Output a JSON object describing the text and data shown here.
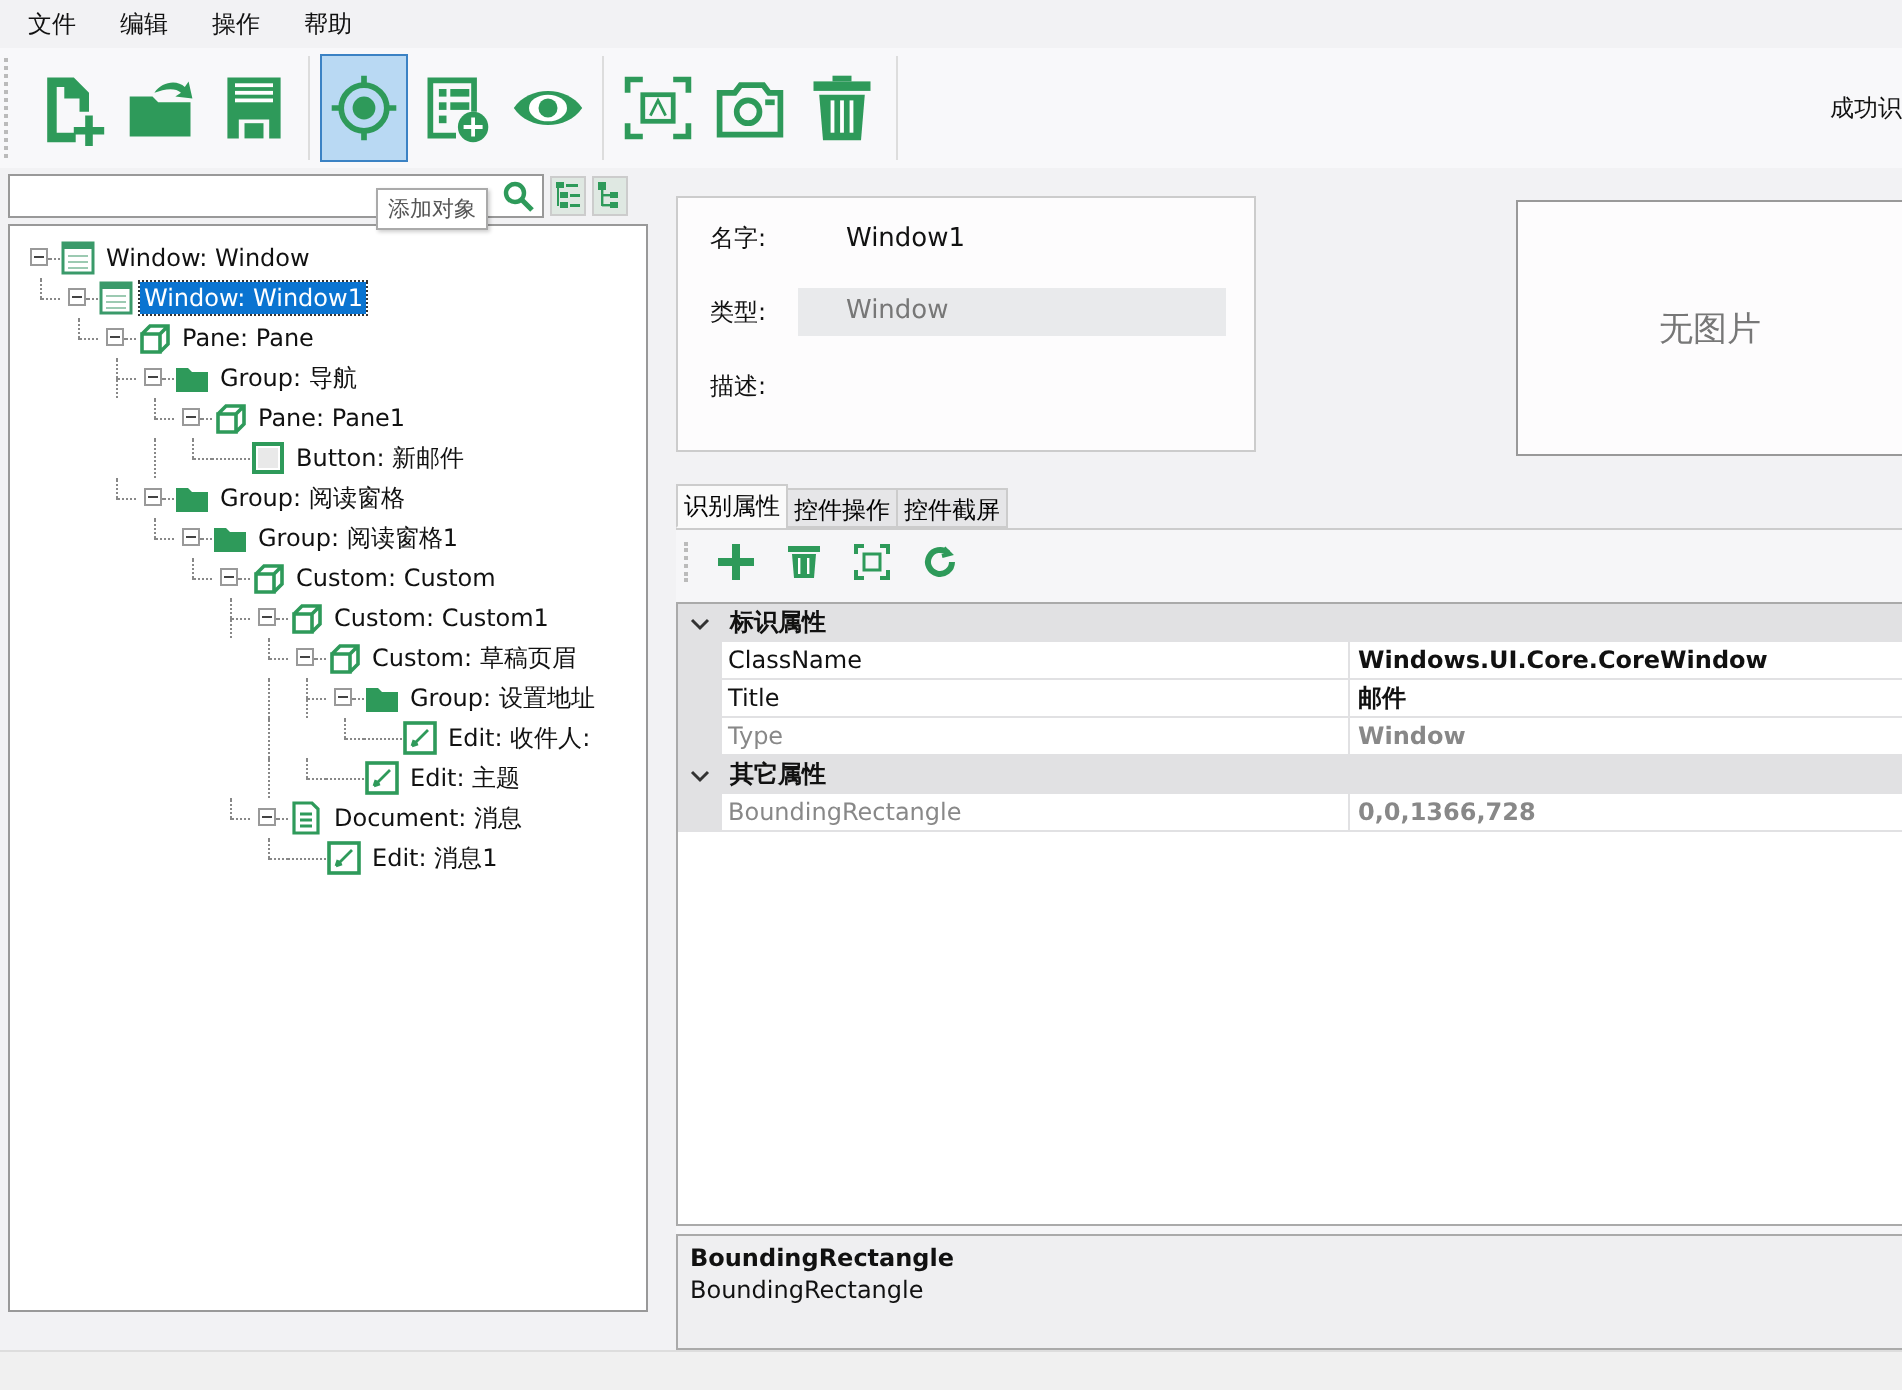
{
  "menu": [
    "文件",
    "编辑",
    "操作",
    "帮助"
  ],
  "toolbar": [
    {
      "kind": "new-file",
      "selected": false
    },
    {
      "kind": "open-folder",
      "selected": false
    },
    {
      "kind": "save",
      "selected": false
    },
    {
      "kind": "target",
      "selected": true
    },
    {
      "kind": "list-add",
      "selected": false
    },
    {
      "kind": "eye",
      "selected": false
    },
    {
      "kind": "capture",
      "selected": false
    },
    {
      "kind": "camera",
      "selected": false
    },
    {
      "kind": "trash",
      "selected": false
    }
  ],
  "status_text": "成功识",
  "tooltip": "添加对象",
  "tree": [
    {
      "kind": "window",
      "label": "Window: Window",
      "selected": false,
      "children": [
        {
          "kind": "window",
          "label": "Window: Window1",
          "selected": true,
          "children": [
            {
              "kind": "pane",
              "label": "Pane: Pane",
              "selected": false,
              "children": [
                {
                  "kind": "group",
                  "label": "Group: 导航",
                  "selected": false,
                  "children": [
                    {
                      "kind": "pane",
                      "label": "Pane: Pane1",
                      "selected": false,
                      "children": [
                        {
                          "kind": "button",
                          "label": "Button: 新邮件",
                          "selected": false
                        }
                      ]
                    }
                  ]
                },
                {
                  "kind": "group",
                  "label": "Group: 阅读窗格",
                  "selected": false,
                  "children": [
                    {
                      "kind": "group",
                      "label": "Group: 阅读窗格1",
                      "selected": false,
                      "children": [
                        {
                          "kind": "pane",
                          "label": "Custom: Custom",
                          "selected": false,
                          "children": [
                            {
                              "kind": "pane",
                              "label": "Custom: Custom1",
                              "selected": false,
                              "children": [
                                {
                                  "kind": "pane",
                                  "label": "Custom: 草稿页眉",
                                  "selected": false,
                                  "children": [
                                    {
                                      "kind": "group",
                                      "label": "Group: 设置地址",
                                      "selected": false,
                                      "children": [
                                        {
                                          "kind": "edit",
                                          "label": "Edit: 收件人:",
                                          "selected": false
                                        }
                                      ]
                                    },
                                    {
                                      "kind": "edit",
                                      "label": "Edit: 主题",
                                      "selected": false
                                    }
                                  ]
                                }
                              ]
                            },
                            {
                              "kind": "document",
                              "label": "Document: 消息",
                              "selected": false,
                              "children": [
                                {
                                  "kind": "edit",
                                  "label": "Edit: 消息1",
                                  "selected": false
                                }
                              ]
                            }
                          ]
                        }
                      ]
                    }
                  ]
                }
              ]
            }
          ]
        }
      ]
    }
  ],
  "info": {
    "name_label": "名字:",
    "name_value": "Window1",
    "type_label": "类型:",
    "type_value": "Window",
    "desc_label": "描述:"
  },
  "image_placeholder": "无图片",
  "tabs": [
    {
      "label": "识别属性",
      "selected": true
    },
    {
      "label": "控件操作",
      "selected": false
    },
    {
      "label": "控件截屏",
      "selected": false
    }
  ],
  "prop_toolbar": [
    {
      "kind": "add"
    },
    {
      "kind": "trash"
    },
    {
      "kind": "capture"
    },
    {
      "kind": "refresh"
    }
  ],
  "properties": [
    {
      "title": "标识属性",
      "expanded": true,
      "rows": [
        {
          "name": "ClassName",
          "value": "Windows.UI.Core.CoreWindow",
          "disabled": false
        },
        {
          "name": "Title",
          "value": "邮件",
          "disabled": false
        },
        {
          "name": "Type",
          "value": "Window",
          "disabled": true
        }
      ]
    },
    {
      "title": "其它属性",
      "expanded": true,
      "rows": [
        {
          "name": "BoundingRectangle",
          "value": "0,0,1366,728",
          "disabled": true
        }
      ]
    }
  ],
  "description": {
    "title": "BoundingRectangle",
    "text": "BoundingRectangle"
  }
}
